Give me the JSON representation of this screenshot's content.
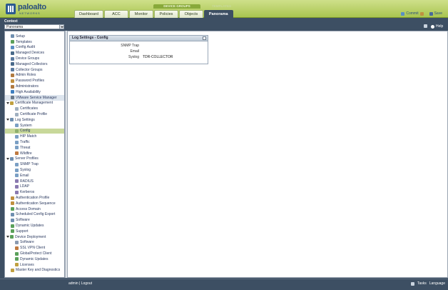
{
  "brand": {
    "name": "paloalto",
    "tagline": "NETWORKS"
  },
  "header": {
    "group_labels": {
      "device_groups": "DEVICE GROUPS",
      "templates": "TEMPLATES"
    },
    "tabs": [
      "Dashboard",
      "ACC",
      "Monitor",
      "Policies",
      "Objects",
      "Panorama"
    ],
    "active_tab": "Panorama",
    "actions": {
      "commit": "Commit",
      "save": "Save"
    }
  },
  "context": {
    "label": "Context",
    "selected": "Panorama"
  },
  "toolbar": {
    "help": "Help"
  },
  "nav": {
    "items": [
      {
        "label": "Setup",
        "icon": "gear-icon",
        "color": "#6f8fb0"
      },
      {
        "label": "Templates",
        "icon": "templates-icon",
        "color": "#5aa05a"
      },
      {
        "label": "Config Audit",
        "icon": "audit-icon",
        "color": "#5a8fc4"
      },
      {
        "label": "Managed Devices",
        "icon": "devices-icon",
        "color": "#4a6a8a"
      },
      {
        "label": "Device Groups",
        "icon": "group-icon",
        "color": "#5a7aa0"
      },
      {
        "label": "Managed Collectors",
        "icon": "collector-icon",
        "color": "#4a6a8a"
      },
      {
        "label": "Collector Groups",
        "icon": "collector-group-icon",
        "color": "#5a7aa0"
      },
      {
        "label": "Admin Roles",
        "icon": "admin-roles-icon",
        "color": "#b07a40"
      },
      {
        "label": "Password Profiles",
        "icon": "password-icon",
        "color": "#c09040"
      },
      {
        "label": "Administrators",
        "icon": "administrators-icon",
        "color": "#b07a40"
      },
      {
        "label": "High Availability",
        "icon": "ha-icon",
        "color": "#3f7fbf"
      },
      {
        "label": "VMware Service Manager",
        "icon": "vmware-icon",
        "color": "#6a7a8a"
      },
      {
        "label": "Certificate Management",
        "icon": "certificate-icon",
        "color": "#c0a040"
      },
      {
        "label": "Certificates",
        "icon": "certificate-icon",
        "color": "#a0b0c0"
      },
      {
        "label": "Certificate Profile",
        "icon": "certificate-profile-icon",
        "color": "#a0b0c0"
      },
      {
        "label": "Log Settings",
        "icon": "log-icon",
        "color": "#6f8fb0"
      },
      {
        "label": "System",
        "icon": "system-log-icon",
        "color": "#7a9fc4"
      },
      {
        "label": "Config",
        "icon": "config-log-icon",
        "color": "#8fb06f"
      },
      {
        "label": "HIP Match",
        "icon": "hip-icon",
        "color": "#7a9fc4"
      },
      {
        "label": "Traffic",
        "icon": "traffic-icon",
        "color": "#7a9fc4"
      },
      {
        "label": "Threat",
        "icon": "threat-icon",
        "color": "#7a9fc4"
      },
      {
        "label": "Wildfire",
        "icon": "wildfire-icon",
        "color": "#c07a40"
      },
      {
        "label": "Server Profiles",
        "icon": "server-profiles-icon",
        "color": "#6f8fb0"
      },
      {
        "label": "SNMP Trap",
        "icon": "snmp-icon",
        "color": "#7a9fc4"
      },
      {
        "label": "Syslog",
        "icon": "syslog-icon",
        "color": "#7a9fc4"
      },
      {
        "label": "Email",
        "icon": "email-icon",
        "color": "#7a9fc4"
      },
      {
        "label": "RADIUS",
        "icon": "radius-icon",
        "color": "#8a7ab0"
      },
      {
        "label": "LDAP",
        "icon": "ldap-icon",
        "color": "#8a7ab0"
      },
      {
        "label": "Kerberos",
        "icon": "kerberos-icon",
        "color": "#8a7ab0"
      },
      {
        "label": "Authentication Profile",
        "icon": "auth-profile-icon",
        "color": "#c09040"
      },
      {
        "label": "Authentication Sequence",
        "icon": "auth-sequence-icon",
        "color": "#c09040"
      },
      {
        "label": "Access Domain",
        "icon": "access-domain-icon",
        "color": "#5aa05a"
      },
      {
        "label": "Scheduled Config Export",
        "icon": "export-icon",
        "color": "#6f8fb0"
      },
      {
        "label": "Software",
        "icon": "software-icon",
        "color": "#6f8fb0"
      },
      {
        "label": "Dynamic Updates",
        "icon": "updates-icon",
        "color": "#5aa05a"
      },
      {
        "label": "Support",
        "icon": "support-icon",
        "color": "#5aa05a"
      },
      {
        "label": "Device Deployment",
        "icon": "deployment-icon",
        "color": "#5aa05a"
      },
      {
        "label": "Software",
        "icon": "software-icon",
        "color": "#8a9ab0"
      },
      {
        "label": "SSL VPN Client",
        "icon": "vpn-icon",
        "color": "#c07a40"
      },
      {
        "label": "GlobalProtect Client",
        "icon": "globalprotect-icon",
        "color": "#5aa05a"
      },
      {
        "label": "Dynamic Updates",
        "icon": "updates-icon",
        "color": "#5aa05a"
      },
      {
        "label": "Licenses",
        "icon": "licenses-icon",
        "color": "#c0a040"
      },
      {
        "label": "Master Key and Diagnostics",
        "icon": "master-key-icon",
        "color": "#c0a040"
      }
    ]
  },
  "panel": {
    "title": "Log Settings - Config",
    "fields": [
      {
        "label": "SNMP Trap",
        "value": ""
      },
      {
        "label": "Email",
        "value": ""
      },
      {
        "label": "Syslog",
        "value": "TDR-COLLECTOR"
      }
    ]
  },
  "footer": {
    "user": "admin",
    "separator": "|",
    "logout": "Logout",
    "tasks": "Tasks",
    "language": "Language"
  }
}
